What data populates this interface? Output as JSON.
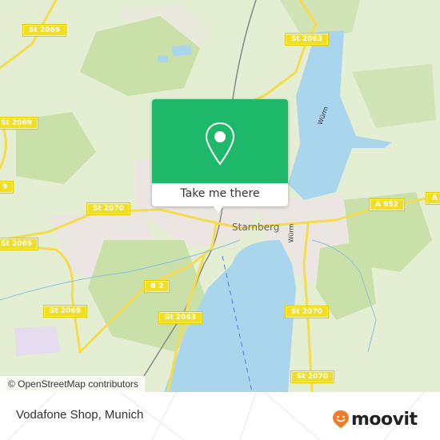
{
  "map": {
    "place_labels": [
      {
        "id": "starnberg",
        "text": "Starnberg"
      }
    ],
    "river_labels": [
      {
        "id": "wurm-north",
        "text": "Würm"
      },
      {
        "id": "wurm-south",
        "text": "Würm"
      }
    ],
    "road_labels": [
      {
        "id": "st2069-top",
        "text": "St 2069"
      },
      {
        "id": "st2063-top",
        "text": "St 2063"
      },
      {
        "id": "st2069-left",
        "text": "St 2069"
      },
      {
        "id": "st2069-left2",
        "text": "9"
      },
      {
        "id": "st2070-mid",
        "text": "St 2070"
      },
      {
        "id": "a952",
        "text": "A 952"
      },
      {
        "id": "a-edge",
        "text": "A"
      },
      {
        "id": "st2069-lower",
        "text": "St 2069"
      },
      {
        "id": "b2",
        "text": "B 2"
      },
      {
        "id": "st2069-bottom",
        "text": "St 2069"
      },
      {
        "id": "st2063-bottom",
        "text": "St 2063"
      },
      {
        "id": "st2070-right",
        "text": "St 2070"
      },
      {
        "id": "st2070-bottom",
        "text": "St 2070"
      }
    ],
    "colors": {
      "water": "#a9d6ec",
      "forest": "#c9e0a8",
      "land": "#e3eed2",
      "urban": "#ece6e2",
      "road": "#f5dc4e",
      "popup_green": "#1eb86a"
    }
  },
  "popup": {
    "icon": "map-pin-icon",
    "cta_label": "Take me there"
  },
  "attribution": "© OpenStreetMap contributors",
  "footer": {
    "title": "Vodafone Shop, Munich",
    "brand": "moovit",
    "brand_icon": "moovit-smiley-pin-icon",
    "brand_color": "#f07c25"
  }
}
